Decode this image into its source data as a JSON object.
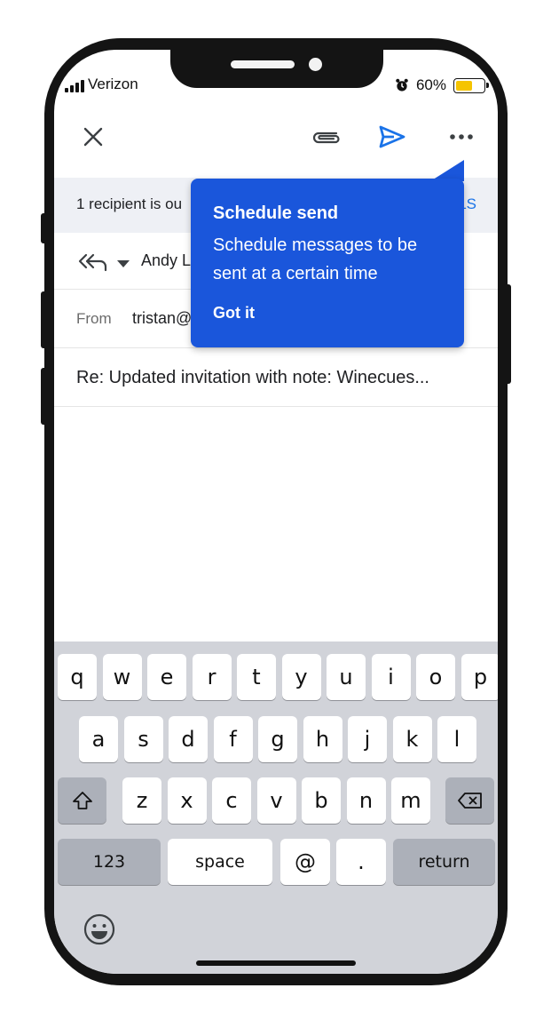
{
  "status_bar": {
    "carrier": "Verizon",
    "battery_percent": "60%",
    "battery_level": 0.6
  },
  "toolbar": {
    "close_icon": "close-icon",
    "attach_icon": "paperclip-icon",
    "send_icon": "send-icon",
    "more_icon": "more-horizontal-icon",
    "accent": "#1a73e8"
  },
  "banner": {
    "text": "1 recipient is ou",
    "action": "LS"
  },
  "reply": {
    "to_name": "Andy L"
  },
  "from": {
    "label": "From",
    "value": "tristan@"
  },
  "subject": "Re: Updated invitation with note: Winecues...",
  "tooltip": {
    "title": "Schedule send",
    "body": "Schedule messages to be sent at a certain time",
    "button": "Got it",
    "color": "#1a56db"
  },
  "keyboard": {
    "row1": [
      "q",
      "w",
      "e",
      "r",
      "t",
      "y",
      "u",
      "i",
      "o",
      "p"
    ],
    "row2": [
      "a",
      "s",
      "d",
      "f",
      "g",
      "h",
      "j",
      "k",
      "l"
    ],
    "row3": [
      "z",
      "x",
      "c",
      "v",
      "b",
      "n",
      "m"
    ],
    "numbers": "123",
    "space": "space",
    "at": "@",
    "period": ".",
    "return": "return"
  }
}
